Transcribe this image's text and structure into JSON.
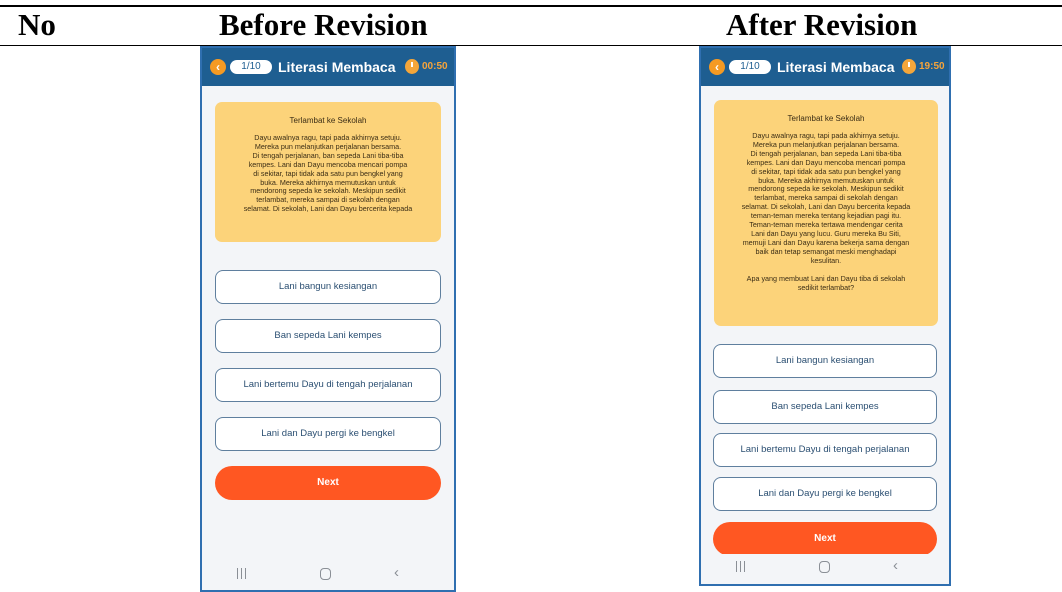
{
  "table": {
    "headers": {
      "no": "No",
      "before": "Before Revision",
      "after": "After Revision"
    }
  },
  "before": {
    "counter": "1/10",
    "app_title": "Literasi Membaca",
    "timer": "00:50",
    "story_title": "Terlambat ke Sekolah",
    "story_text": "Dayu awalnya ragu, tapi pada akhirnya setuju.\nMereka pun melanjutkan perjalanan bersama.\nDi tengah perjalanan, ban sepeda Lani tiba-tiba\nkempes. Lani dan Dayu mencoba mencari pompa\ndi sekitar, tapi tidak ada satu pun bengkel yang\nbuka. Mereka akhirnya memutuskan untuk\nmendorong sepeda ke sekolah. Meskipun sedikit\nterlambat, mereka sampai di sekolah dengan\nselamat. Di sekolah, Lani dan Dayu bercerita kepada",
    "options": [
      "Lani bangun kesiangan",
      "Ban sepeda Lani kempes",
      "Lani bertemu Dayu di tengah perjalanan",
      "Lani dan Dayu pergi ke bengkel"
    ],
    "next_label": "Next"
  },
  "after": {
    "counter": "1/10",
    "app_title": "Literasi Membaca",
    "timer": "19:50",
    "story_title": "Terlambat ke Sekolah",
    "story_text": "Dayu awalnya ragu, tapi pada akhirnya setuju.\nMereka pun melanjutkan perjalanan bersama.\nDi tengah perjalanan, ban sepeda Lani tiba-tiba\nkempes. Lani dan Dayu mencoba mencari pompa\ndi sekitar, tapi tidak ada satu pun bengkel yang\nbuka. Mereka akhirnya memutuskan untuk\nmendorong sepeda ke sekolah. Meskipun sedikit\nterlambat, mereka sampai di sekolah dengan\nselamat. Di sekolah, Lani dan Dayu bercerita kepada\nteman-teman mereka tentang kejadian pagi itu.\nTeman-teman mereka tertawa mendengar cerita\nLani dan Dayu yang lucu. Guru mereka Bu Siti,\nmemuji Lani dan Dayu karena bekerja sama dengan\nbaik dan tetap semangat meski menghadapi\nkesulitan.",
    "question": "Apa yang membuat Lani dan Dayu tiba di sekolah\nsedikit terlambat?",
    "options": [
      "Lani bangun kesiangan",
      "Ban sepeda Lani kempes",
      "Lani bertemu Dayu di tengah perjalanan",
      "Lani dan Dayu pergi ke bengkel"
    ],
    "next_label": "Next"
  },
  "icons": {
    "back": "chevron-left-icon",
    "timer": "stopwatch-icon",
    "nav_recents": "recents-icon",
    "nav_home": "home-icon",
    "nav_back": "back-icon"
  },
  "colors": {
    "app_bar": "#1e5e91",
    "story_card": "#fcd37a",
    "next_button": "#ff5722",
    "accent_orange": "#f59a23",
    "phone_border": "#2f6fb0"
  }
}
